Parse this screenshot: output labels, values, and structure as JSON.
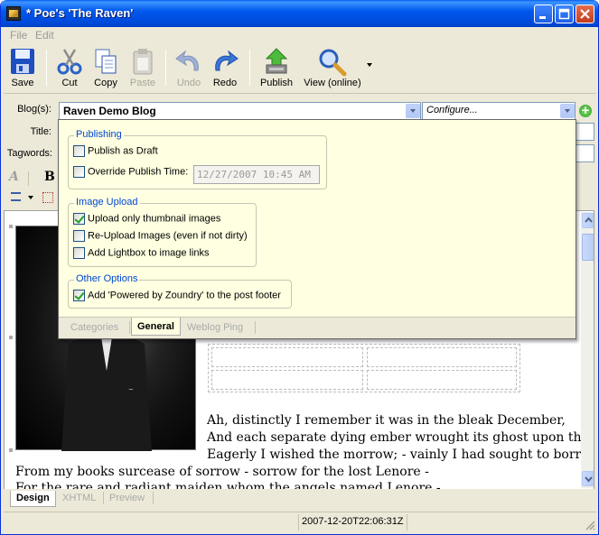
{
  "window": {
    "title": "* Poe's 'The Raven'"
  },
  "menu": [
    "File",
    "Edit"
  ],
  "toolbar": {
    "save": "Save",
    "cut": "Cut",
    "copy": "Copy",
    "paste": "Paste",
    "undo": "Undo",
    "redo": "Redo",
    "publish": "Publish",
    "view": "View (online)"
  },
  "fields": {
    "blogs_label": "Blog(s):",
    "title_label": "Title:",
    "tags_label": "Tagwords:"
  },
  "blog": {
    "value": "Raven Demo Blog",
    "config": "Configure..."
  },
  "popup": {
    "publishing": {
      "title": "Publishing",
      "draft": {
        "label": "Publish as Draft",
        "checked": false
      },
      "override": {
        "label": "Override Publish Time:",
        "checked": false
      },
      "time": "12/27/2007 10:45 AM"
    },
    "image_upload": {
      "title": "Image Upload",
      "items": [
        {
          "label": "Upload only thumbnail images",
          "checked": true
        },
        {
          "label": "Re-Upload Images (even if not dirty)",
          "checked": false
        },
        {
          "label": "Add Lightbox to image links",
          "checked": false
        }
      ]
    },
    "other": {
      "title": "Other Options",
      "powered": {
        "label": "Add 'Powered by Zoundry' to the post footer",
        "checked": true
      }
    },
    "tabs": [
      "Categories",
      "General",
      "Weblog Ping"
    ]
  },
  "editor": {
    "lines": [
      "Ah, distinctly I remember it was in the bleak December,",
      "And each separate dying ember wrought its ghost upon the floor.",
      "Eagerly I wished the morrow; - vainly I had sought to borrow",
      "From my books surcease of sorrow - sorrow for the lost Lenore -",
      "For the rare and radiant maiden whom the angels named Lenore -"
    ]
  },
  "bottom_tabs": [
    "Design",
    "XHTML",
    "Preview"
  ],
  "status": {
    "timestamp": "2007-12-20T22:06:31Z"
  },
  "colors": {
    "titlebar": "#0058ee",
    "popup_bg": "#ffffe1",
    "group_title": "#0046d5"
  }
}
